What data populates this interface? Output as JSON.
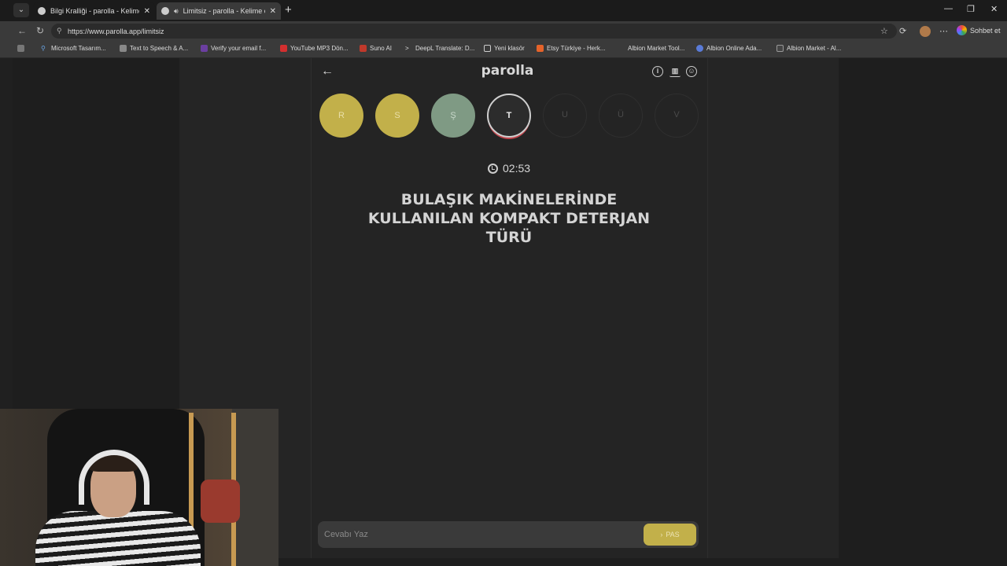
{
  "browser": {
    "tabs": [
      {
        "title": "Bilgi Kralliği - parolla - Kelime oyu",
        "active": false
      },
      {
        "title": "Limitsiz - parolla - Kelime oyu",
        "active": true
      }
    ],
    "url": "https://www.parolla.app/limitsiz",
    "chat_label": "Sohbet et",
    "bookmarks": [
      "Microsoft Tasarım...",
      "Text to Speech & A...",
      "Verify your email f...",
      "YouTube MP3 Dön...",
      "Suno AI",
      "DeepL Translate: D...",
      "Yeni klasör",
      "Etsy Türkiye - Herk...",
      "Albion Market Tool...",
      "Albion Online Ada...",
      "Albion Market - Al..."
    ]
  },
  "game": {
    "logo": "parolla",
    "letters": [
      {
        "char": "R",
        "state": "correct"
      },
      {
        "char": "S",
        "state": "correct"
      },
      {
        "char": "Ş",
        "state": "passed"
      },
      {
        "char": "T",
        "state": "active"
      },
      {
        "char": "U",
        "state": "pending"
      },
      {
        "char": "Ü",
        "state": "pending"
      },
      {
        "char": "V",
        "state": "pending"
      }
    ],
    "timer": "02:53",
    "question": "BULAŞIK MAKİNELERİNDE KULLANILAN KOMPAKT DETERJAN TÜRÜ",
    "answer_placeholder": "Cevabı Yaz",
    "pass_label": "PAS"
  },
  "colors": {
    "correct": "#c2b04a",
    "passed": "#7f9a84",
    "active_ring": "#c2464d"
  }
}
